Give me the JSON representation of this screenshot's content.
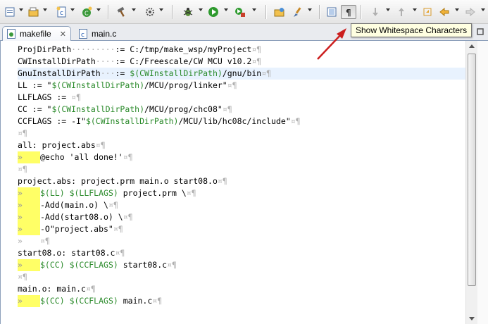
{
  "tooltip": "Show Whitespace Characters",
  "tabs": [
    {
      "label": "makefile",
      "close": "✕"
    },
    {
      "label": "main.c"
    }
  ],
  "editor": {
    "tab_glyph": "»",
    "line_end_glyph": "¤¶",
    "lines": [
      {
        "segs": [
          [
            "t",
            "ProjDirPath"
          ],
          [
            "w",
            "·········"
          ],
          [
            "t",
            ":= C:/tmp/make_wsp/myProject"
          ]
        ]
      },
      {
        "segs": [
          [
            "t",
            "CWInstallDirPath"
          ],
          [
            "w",
            "····"
          ],
          [
            "t",
            ":= C:/Freescale/CW MCU v10.2"
          ]
        ]
      },
      {
        "current": true,
        "segs": [
          [
            "t",
            "GnuInstallDirPath"
          ],
          [
            "w",
            "···"
          ],
          [
            "t",
            ":= "
          ],
          [
            "v",
            "$(CWInstallDirPath)"
          ],
          [
            "t",
            "/gnu/bin"
          ]
        ]
      },
      {
        "segs": [
          [
            "t",
            "LL := \""
          ],
          [
            "v",
            "$(CWInstallDirPath)"
          ],
          [
            "t",
            "/MCU/prog/linker\""
          ]
        ]
      },
      {
        "segs": [
          [
            "t",
            "LLFLAGS := "
          ]
        ]
      },
      {
        "segs": [
          [
            "t",
            "CC := \""
          ],
          [
            "v",
            "$(CWInstallDirPath)"
          ],
          [
            "t",
            "/MCU/prog/chc08\""
          ]
        ]
      },
      {
        "segs": [
          [
            "t",
            "CCFLAGS := -I\""
          ],
          [
            "v",
            "$(CWInstallDirPath)"
          ],
          [
            "t",
            "/MCU/lib/hc08c/include\""
          ]
        ]
      },
      {
        "segs": []
      },
      {
        "segs": [
          [
            "t",
            "all: project.abs"
          ]
        ]
      },
      {
        "tab": "hl",
        "segs": [
          [
            "t",
            "@echo 'all done!'"
          ]
        ]
      },
      {
        "segs": []
      },
      {
        "segs": [
          [
            "t",
            "project.abs: project.prm main.o start08.o"
          ]
        ]
      },
      {
        "tab": "hl",
        "segs": [
          [
            "v",
            "$(LL)"
          ],
          [
            "t",
            " "
          ],
          [
            "v",
            "$(LLFLAGS)"
          ],
          [
            "t",
            " project.prm \\"
          ]
        ]
      },
      {
        "tab": "hl",
        "segs": [
          [
            "t",
            "-Add(main.o) \\"
          ]
        ]
      },
      {
        "tab": "hl",
        "segs": [
          [
            "t",
            "-Add(start08.o) \\"
          ]
        ]
      },
      {
        "tab": "hl",
        "segs": [
          [
            "t",
            "-O\"project.abs\""
          ]
        ]
      },
      {
        "tab": "plain",
        "segs": []
      },
      {
        "segs": [
          [
            "t",
            "start08.o: start08.c"
          ]
        ]
      },
      {
        "tab": "hl",
        "segs": [
          [
            "v",
            "$(CC)"
          ],
          [
            "t",
            " "
          ],
          [
            "v",
            "$(CCFLAGS)"
          ],
          [
            "t",
            " start08.c"
          ]
        ]
      },
      {
        "segs": []
      },
      {
        "segs": [
          [
            "t",
            "main.o: main.c"
          ]
        ]
      },
      {
        "tab": "hl",
        "segs": [
          [
            "v",
            "$(CC)"
          ],
          [
            "t",
            " "
          ],
          [
            "v",
            "$(CCFLAGS)"
          ],
          [
            "t",
            " main.c"
          ]
        ]
      }
    ]
  },
  "colors": {
    "variable": "#2a8a2a",
    "whitespace_glyph": "#b0b0b0",
    "tab_highlight": "#ffff66",
    "current_line": "#e8f2fe",
    "arrow": "#cc1f1f"
  },
  "toolbar_icons": [
    "new-file-icon",
    "open-project-icon",
    "new-source-icon",
    "new-class-icon",
    "build-hammer-icon",
    "build-settings-icon",
    "debug-bug-icon",
    "run-icon",
    "external-tools-icon",
    "open-folder-icon",
    "search-brush-icon",
    "block-selection-icon",
    "show-whitespace-icon",
    "next-annotation-icon",
    "previous-annotation-icon",
    "back-arrow-icon",
    "forward-arrow-icon"
  ]
}
